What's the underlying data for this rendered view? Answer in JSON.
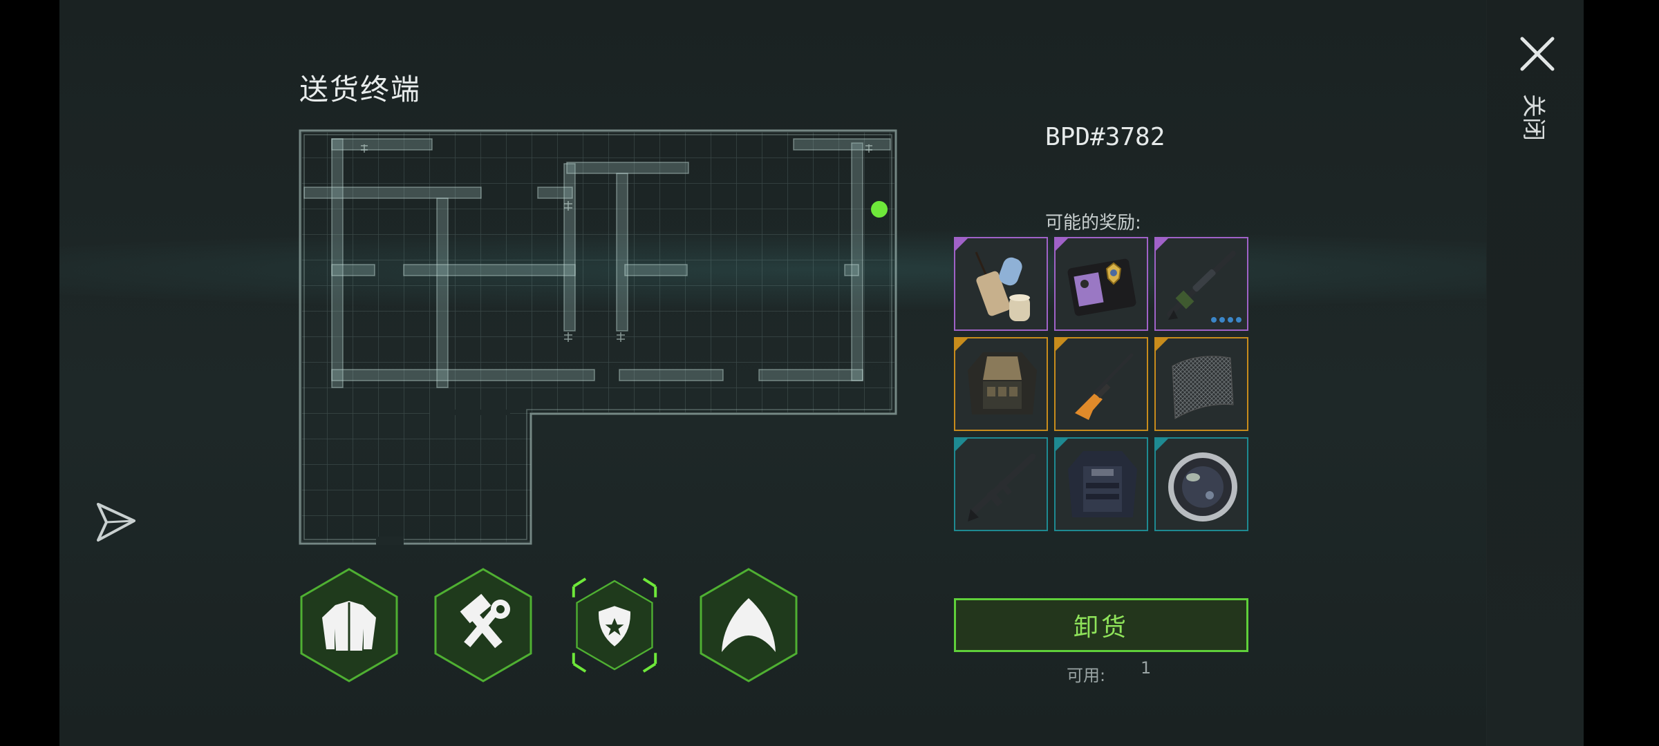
{
  "terminal": {
    "title": "送货终端",
    "code": "BPD#3782",
    "rewards_label": "可能的奖励:",
    "unload_label": "卸货",
    "available_label": "可用:",
    "available_value": "1",
    "close_label": "关闭"
  },
  "rewards": [
    {
      "name": "rolled-scroll-icon",
      "rarity": "purple",
      "dots": 0
    },
    {
      "name": "police-badge-wallet-icon",
      "rarity": "purple",
      "dots": 0
    },
    {
      "name": "sniper-rifle-icon",
      "rarity": "purple",
      "dots": 4
    },
    {
      "name": "tactical-jacket-icon",
      "rarity": "orange",
      "dots": 0
    },
    {
      "name": "orange-rifle-icon",
      "rarity": "orange",
      "dots": 0
    },
    {
      "name": "mesh-fabric-icon",
      "rarity": "orange",
      "dots": 0
    },
    {
      "name": "assault-rifle-icon",
      "rarity": "teal",
      "dots": 0
    },
    {
      "name": "police-vest-icon",
      "rarity": "teal",
      "dots": 0
    },
    {
      "name": "lens-icon",
      "rarity": "teal",
      "dots": 0
    }
  ],
  "category_buttons": [
    {
      "name": "clothing-category-button",
      "icon": "jacket-icon",
      "selected": false
    },
    {
      "name": "tools-category-button",
      "icon": "hammer-wrench-icon",
      "selected": false
    },
    {
      "name": "police-category-button",
      "icon": "police-badge-icon",
      "selected": true
    },
    {
      "name": "shark-fin-category-button",
      "icon": "shark-fin-icon",
      "selected": false
    }
  ],
  "colors": {
    "purple": "#a062c8",
    "orange": "#c88c1c",
    "teal": "#1e8a92",
    "accent_green": "#5fd03a",
    "location_marker": "#6ee83a"
  }
}
